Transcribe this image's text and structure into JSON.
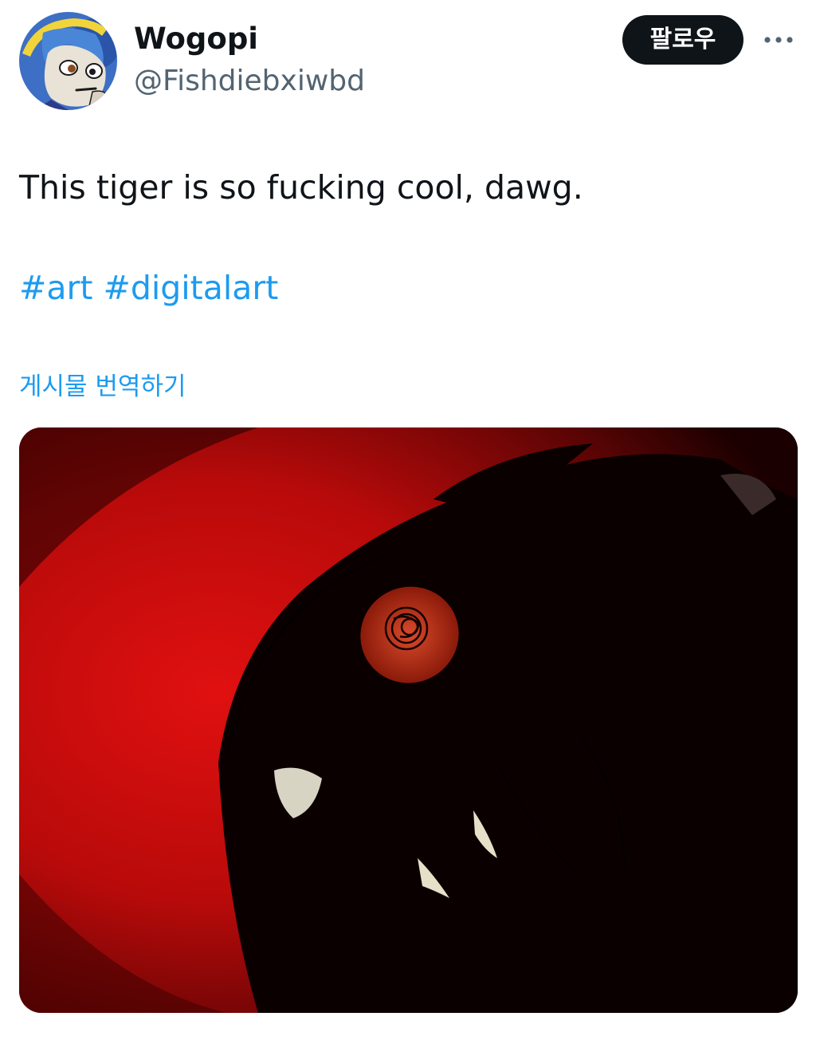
{
  "tweet": {
    "author": {
      "display_name": "Wogopi",
      "handle": "@Fishdiebxiwbd",
      "avatar_icon": "cartoon-character-avatar"
    },
    "actions": {
      "follow_label": "팔로우",
      "more_icon": "more-dots-icon"
    },
    "text": "This tiger is so fucking cool, dawg.",
    "hashtags": [
      "#art",
      "#digitalart"
    ],
    "translate_label": "게시물 번역하기",
    "media": {
      "type": "image",
      "subject": "red-black-tiger-artwork"
    }
  },
  "colors": {
    "text_primary": "#0f1419",
    "text_secondary": "#536471",
    "link": "#1d9bf0",
    "follow_button_bg": "#0f1419",
    "follow_button_text": "#ffffff"
  }
}
